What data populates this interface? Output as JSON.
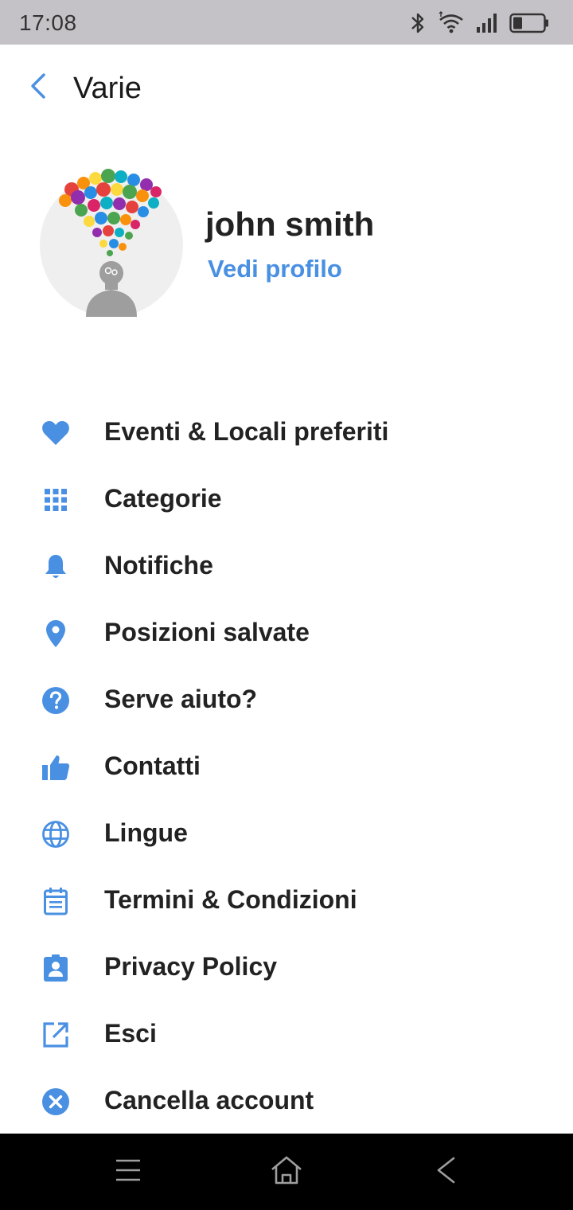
{
  "status_bar": {
    "time": "17:08",
    "icons": [
      "bluetooth-icon",
      "wifi-icon",
      "signal-icon",
      "battery-icon"
    ]
  },
  "header": {
    "title": "Varie",
    "back_icon": "chevron-left-icon"
  },
  "profile": {
    "name": "john smith",
    "link_label": "Vedi profilo",
    "avatar": "head-with-colorful-ideas-avatar"
  },
  "menu": {
    "items": [
      {
        "label": "Eventi & Locali preferiti",
        "icon": "heart-icon"
      },
      {
        "label": "Categorie",
        "icon": "grid-icon"
      },
      {
        "label": "Notifiche",
        "icon": "bell-icon"
      },
      {
        "label": "Posizioni salvate",
        "icon": "location-pin-icon"
      },
      {
        "label": "Serve aiuto?",
        "icon": "help-icon"
      },
      {
        "label": "Contatti",
        "icon": "thumbs-up-icon"
      },
      {
        "label": "Lingue",
        "icon": "globe-icon"
      },
      {
        "label": "Termini & Condizioni",
        "icon": "document-icon"
      },
      {
        "label": "Privacy Policy",
        "icon": "badge-icon"
      },
      {
        "label": "Esci",
        "icon": "open-external-icon"
      },
      {
        "label": "Cancella account",
        "icon": "cancel-circle-icon"
      }
    ]
  },
  "nav_bar": {
    "buttons": [
      "menu-icon",
      "home-icon",
      "back-icon"
    ]
  },
  "colors": {
    "accent": "#4a90e2",
    "text": "#222222",
    "status_bar": "#c4c2c6",
    "nav_bar": "#000000"
  }
}
